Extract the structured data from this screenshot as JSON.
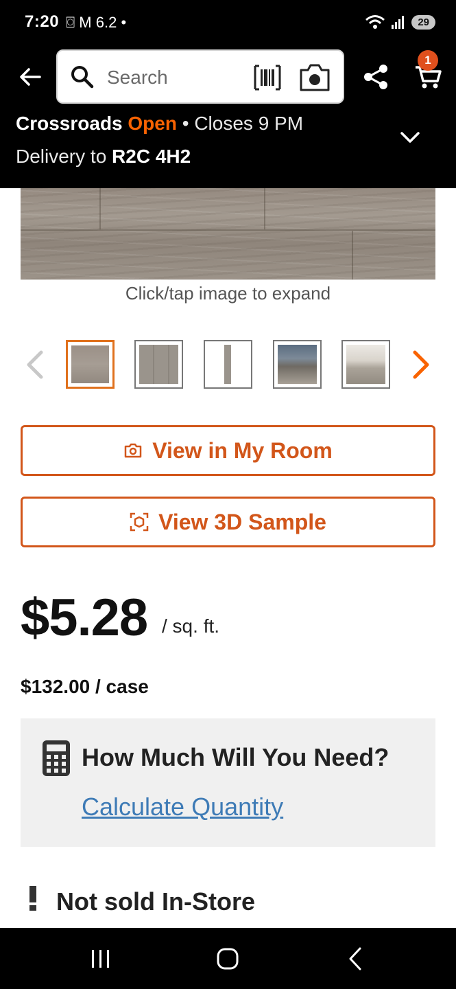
{
  "status_bar": {
    "time": "7:20",
    "left_icons_text": "⌼ M 6.2 •",
    "battery": "29"
  },
  "header": {
    "search": {
      "placeholder": "Search"
    },
    "cart_count": "1",
    "store": {
      "name": "Crossroads",
      "status": "Open",
      "closes": "• Closes 9 PM"
    },
    "delivery": {
      "prefix": "Delivery to ",
      "zip": "R2C 4H2"
    }
  },
  "product": {
    "expand_hint": "Click/tap image to expand",
    "thumbnails": [
      "flooring-swatch",
      "plank-closeup",
      "single-plank",
      "living-room-scene",
      "bathroom-scene"
    ]
  },
  "actions": {
    "view_in_room": "View in My Room",
    "view_3d": "View 3D Sample"
  },
  "price": {
    "main": "$5.28",
    "unit": "/ sq. ft.",
    "per_case": "$132.00 / case"
  },
  "calculator": {
    "title": "How Much Will You Need?",
    "link": "Calculate Quantity"
  },
  "availability": {
    "text": "Not sold In-Store"
  },
  "colors": {
    "accent": "#f96302",
    "button_border": "#d2561a",
    "link": "#3e7bb6",
    "badge": "#e0501d"
  }
}
